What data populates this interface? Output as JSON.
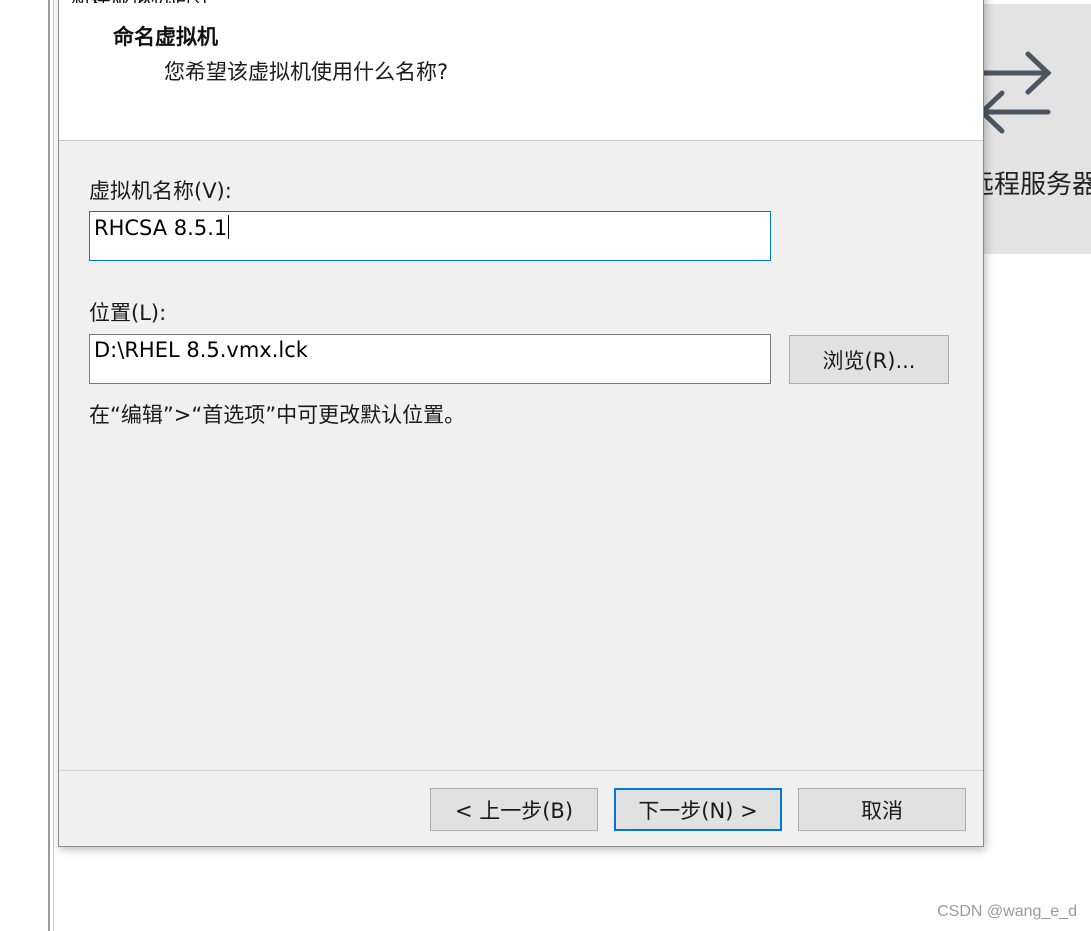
{
  "background": {
    "tile_label": "远程服务器",
    "tile_icon": "swap-arrows-icon",
    "watermark": "CSDN @wang_e_d"
  },
  "dialog": {
    "title": "新建虚拟机向导",
    "close_glyph": "✕",
    "header": {
      "title": "命名虚拟机",
      "subtitle": "您希望该虚拟机使用什么名称?"
    },
    "vm_name": {
      "label": "虚拟机名称(V):",
      "value": "RHCSA 8.5.1"
    },
    "location": {
      "label": "位置(L):",
      "value": "D:\\RHEL 8.5.vmx.lck",
      "browse_label": "浏览(R)..."
    },
    "hint": "在“编辑”>“首选项”中可更改默认位置。",
    "buttons": {
      "back": "< 上一步(B)",
      "next": "下一步(N) >",
      "cancel": "取消"
    },
    "colors": {
      "accent": "#0078d7",
      "dialog_bg": "#f0f0f0"
    }
  }
}
